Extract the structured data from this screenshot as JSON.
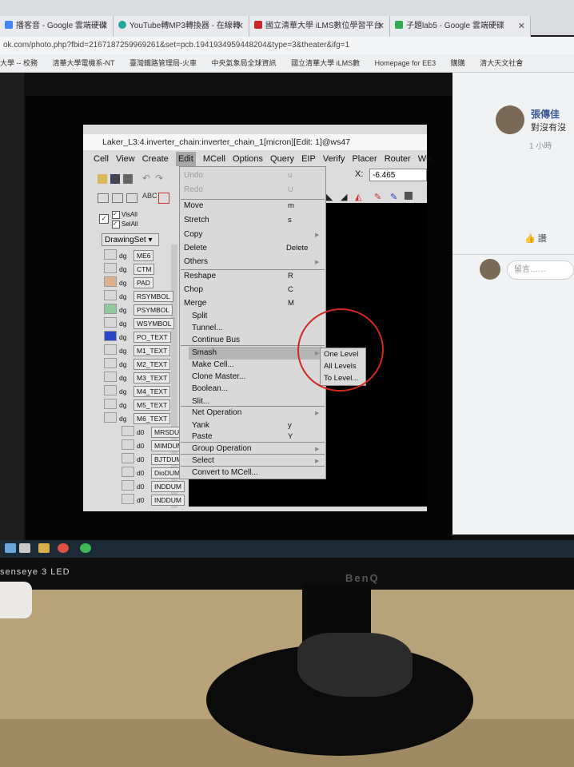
{
  "browser": {
    "tabs": [
      {
        "title": "播客音 - Google 雲端硬碟",
        "color": "#4285f4"
      },
      {
        "title": "YouTube轉MP3轉換器 - 在線轉",
        "color": "#26a69a"
      },
      {
        "title": "國立清華大學 iLMS數位學習平台",
        "color": "#c62828"
      },
      {
        "title": "子題lab5 - Google 雲端硬碟",
        "color": "#34a853"
      }
    ],
    "url": "ok.com/photo.php?fbid=2167187259969261&set=pcb.1941934959448204&type=3&theater&ifg=1",
    "bookmarks": [
      "大學 -- 校務",
      "清華大學電機系-NT",
      "臺灣鐵路管理局-火車",
      "中央氣象局全球資訊",
      "國立清華大學 iLMS數",
      "Homepage for EE3",
      "購購",
      "清大天文社會"
    ]
  },
  "facebook": {
    "poster_name": "張傳佳",
    "post_text": "對沒有沒",
    "time": "1 小時",
    "like_label": "讚",
    "comment_placeholder": "留言……"
  },
  "laker": {
    "title": "Laker_L3:4.inverter_chain:inverter_chain_1[micron][Edit: 1]@ws47",
    "menu": [
      "Cell",
      "View",
      "Create",
      "Edit",
      "MCell",
      "Options",
      "Query",
      "EIP",
      "Verify",
      "Placer",
      "Router",
      "Win"
    ],
    "active_menu": "Edit",
    "x_label": "X:",
    "x_value": "-6.465",
    "visall": "VisAll",
    "selall": "SelAll",
    "drawingset": "DrawingSet",
    "layers": [
      {
        "tag": "dg",
        "name": "ME6",
        "color": "#d8d8d8"
      },
      {
        "tag": "dg",
        "name": "CTM",
        "color": "#d8d8d8"
      },
      {
        "tag": "dg",
        "name": "PAD",
        "color": "#e0b08a"
      },
      {
        "tag": "dg",
        "name": "RSYMBOL",
        "color": "#d8d8d8"
      },
      {
        "tag": "dg",
        "name": "PSYMBOL",
        "color": "#8fc89a"
      },
      {
        "tag": "dg",
        "name": "WSYMBOL",
        "color": "#d8d8d8"
      },
      {
        "tag": "dg",
        "name": "PO_TEXT",
        "color": "#2a46c8"
      },
      {
        "tag": "dg",
        "name": "M1_TEXT",
        "color": "#d8d8d8"
      },
      {
        "tag": "dg",
        "name": "M2_TEXT",
        "color": "#d8d8d8"
      },
      {
        "tag": "dg",
        "name": "M3_TEXT",
        "color": "#d8d8d8"
      },
      {
        "tag": "dg",
        "name": "M4_TEXT",
        "color": "#d8d8d8"
      },
      {
        "tag": "dg",
        "name": "M5_TEXT",
        "color": "#d8d8d8"
      },
      {
        "tag": "dg",
        "name": "M6_TEXT",
        "color": "#d8d8d8"
      },
      {
        "tag": "d0",
        "name": "MRSDUM",
        "color": "#d8d8d8"
      },
      {
        "tag": "d0",
        "name": "MIMDUM",
        "color": "#d8d8d8"
      },
      {
        "tag": "d0",
        "name": "BJTDUM",
        "color": "#d8d8d8"
      },
      {
        "tag": "d0",
        "name": "DioDUM",
        "color": "#d8d8d8"
      },
      {
        "tag": "d0",
        "name": "INDDUM",
        "color": "#d8d8d8"
      },
      {
        "tag": "d0",
        "name": "INDDUM",
        "color": "#d8d8d8"
      }
    ],
    "edit_menu": [
      {
        "label": "Undo",
        "shortcut": "u",
        "disabled": true
      },
      {
        "label": "Redo",
        "shortcut": "U",
        "disabled": true
      },
      {
        "label": "Move",
        "shortcut": "m"
      },
      {
        "label": "Stretch",
        "shortcut": "s"
      },
      {
        "label": "Copy",
        "shortcut": "",
        "submenu": true
      },
      {
        "label": "Delete",
        "shortcut": "Delete"
      },
      {
        "label": "Others",
        "shortcut": "",
        "submenu": true
      },
      {
        "label": "Reshape",
        "shortcut": "R"
      },
      {
        "label": "Chop",
        "shortcut": "C"
      },
      {
        "label": "Merge",
        "shortcut": "M"
      },
      {
        "label": "Split",
        "shortcut": ""
      },
      {
        "label": "Tunnel...",
        "shortcut": ""
      },
      {
        "label": "Continue Bus",
        "shortcut": ""
      },
      {
        "label": "Smash",
        "shortcut": "",
        "submenu": true,
        "highlighted": true
      },
      {
        "label": "Make Cell...",
        "shortcut": ""
      },
      {
        "label": "Clone Master...",
        "shortcut": ""
      },
      {
        "label": "Boolean...",
        "shortcut": ""
      },
      {
        "label": "Slit...",
        "shortcut": ""
      },
      {
        "label": "Net Operation",
        "shortcut": "",
        "submenu": true
      },
      {
        "label": "Yank",
        "shortcut": "y"
      },
      {
        "label": "Paste",
        "shortcut": "Y"
      },
      {
        "label": "Group Operation",
        "shortcut": "",
        "submenu": true
      },
      {
        "label": "Select",
        "shortcut": "",
        "submenu": true
      },
      {
        "label": "Convert to MCell...",
        "shortcut": ""
      }
    ],
    "smash_submenu": [
      "One Level",
      "All Levels",
      "To Level..."
    ]
  },
  "monitor": {
    "left_brand": "senseye 3  LED",
    "brand": "BenQ"
  },
  "colors": {
    "annotation_circle": "#d0271f",
    "canvas": "#000000"
  }
}
